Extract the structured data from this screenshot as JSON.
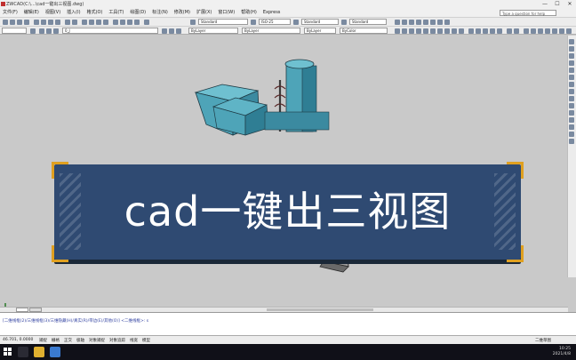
{
  "window": {
    "title": "ZWCAD(C:\\...\\cad一键出三视图.dwg)",
    "minimize_glyph": "—",
    "maximize_glyph": "☐",
    "close_glyph": "✕"
  },
  "menu": {
    "items": [
      "文件(F)",
      "编辑(E)",
      "视图(V)",
      "插入(I)",
      "格式(O)",
      "工具(T)",
      "绘图(D)",
      "标注(N)",
      "修改(M)",
      "扩展(X)",
      "窗口(W)",
      "帮助(H)",
      "Express"
    ],
    "search_placeholder": "Type a question for help"
  },
  "toolbar1": {
    "text_style": "Standard",
    "dim_style": "ISO-25",
    "table_style": "Standard",
    "multileader_style": "Standard"
  },
  "toolbar2": {
    "layer": "0_J",
    "color": "ByLayer",
    "linetype": "ByLayer",
    "lineweight": "ByLayer",
    "plotstyle": "ByColor"
  },
  "banner": {
    "text": "cad一键出三视图"
  },
  "command_line": {
    "history": "[二维线框(2)/三维线框(3)/三维隐藏(H)/真实(R)/带边(E)/其他(O)] <二维线框>: s"
  },
  "status_bar": {
    "coords": "46.701, 0.0000",
    "modes": [
      "捕捉",
      "栅格",
      "正交",
      "极轴",
      "对象捕捉",
      "对象追踪",
      "线宽",
      "模型"
    ],
    "workspace": "二维草图"
  },
  "taskbar": {
    "time": "10:25",
    "date": "2021/4/8"
  },
  "colors": {
    "banner_bg": "#2f4a72",
    "banner_accent": "#e0a020",
    "model_fill": "#4ea4b8",
    "canvas_bg": "#c9c9c9"
  }
}
